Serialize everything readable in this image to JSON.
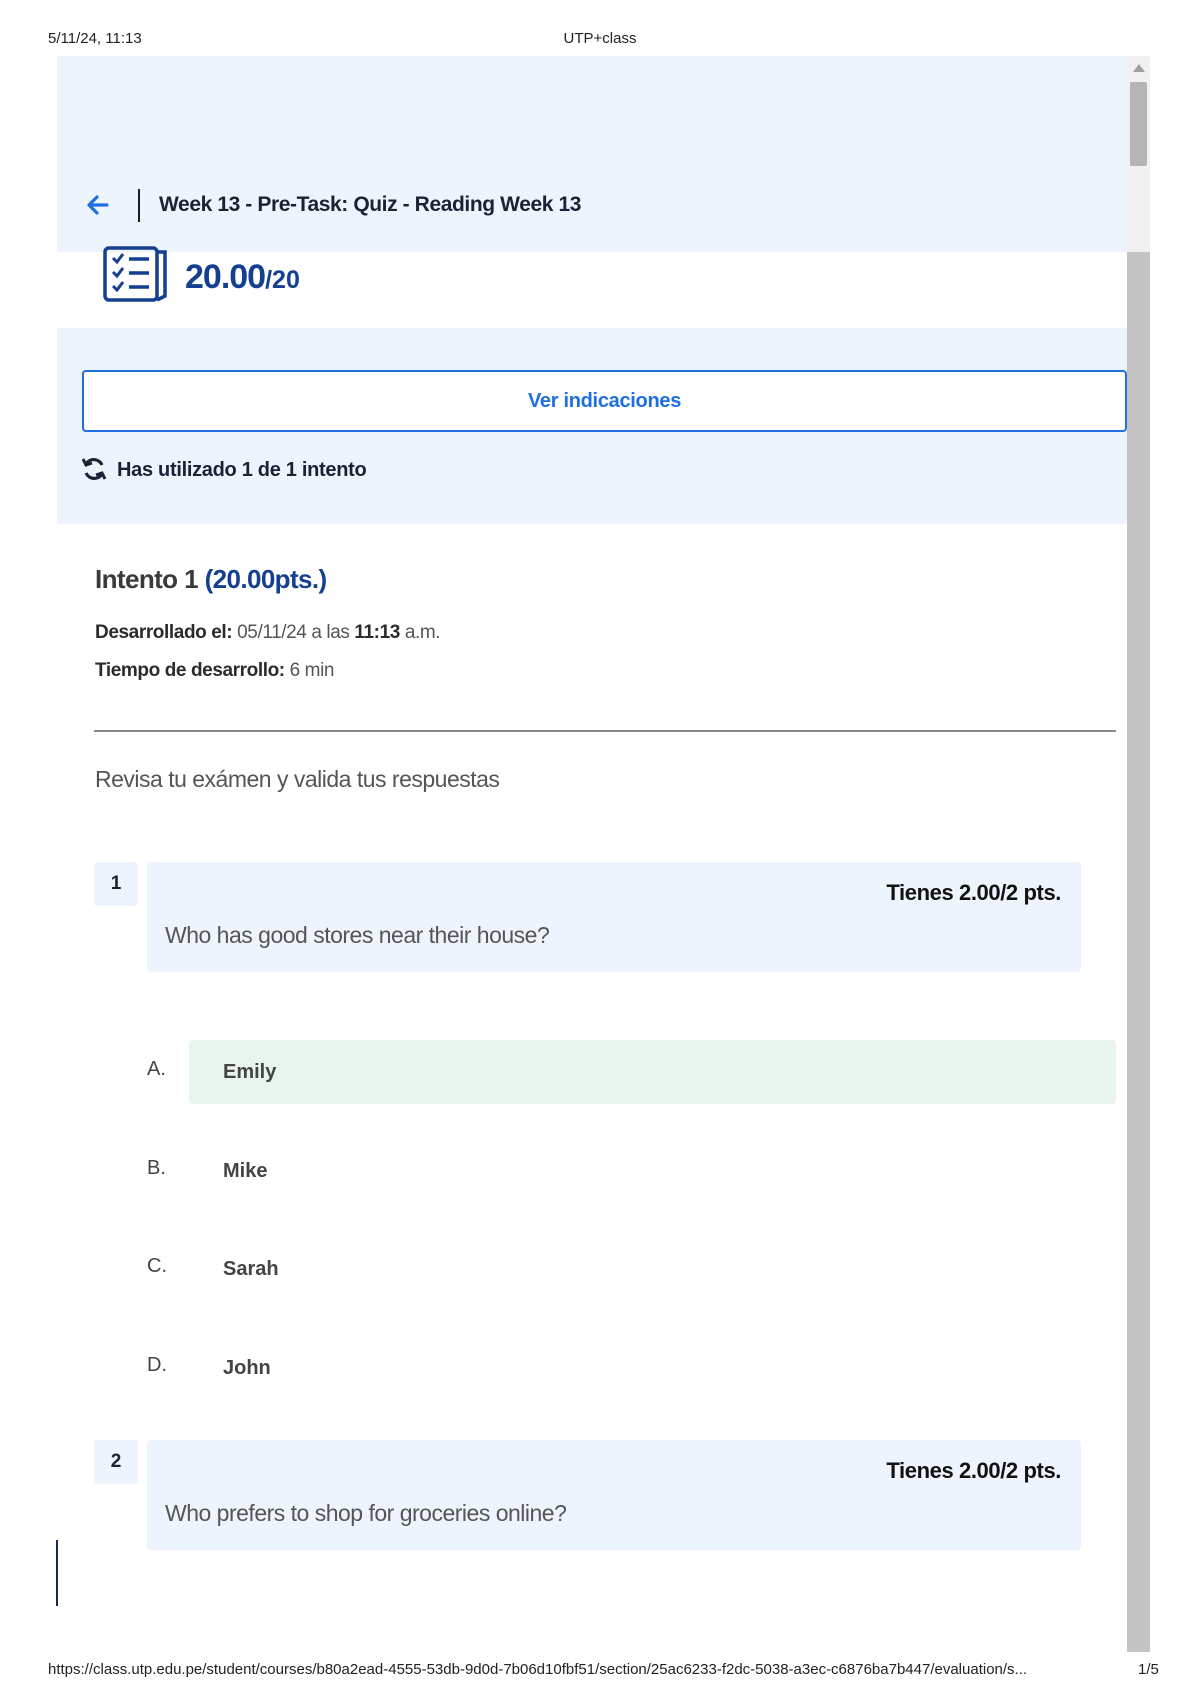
{
  "print": {
    "date": "5/11/24, 11:13",
    "title": "UTP+class",
    "url": "https://class.utp.edu.pe/student/courses/b80a2ead-4555-53db-9d0d-7b06d10fbf51/section/25ac6233-f2dc-5038-a3ec-c6876ba7b447/evaluation/s...",
    "page": "1/5"
  },
  "header": {
    "back_icon": "arrow-left-icon",
    "title": "Week 13 - Pre-Task: Quiz - Reading Week 13"
  },
  "score": {
    "icon": "checklist-icon",
    "value": "20.00",
    "max": "/20"
  },
  "info": {
    "indicaciones_label": "Ver indicaciones",
    "attempts_icon": "refresh-icon",
    "attempts_text": "Has utilizado 1 de 1 intento"
  },
  "attempt": {
    "label": "Intento 1",
    "points": "(20.00pts.)",
    "developed_label": "Desarrollado el:",
    "developed_date": "05/11/24",
    "developed_sep": "a las",
    "developed_time": "11:13",
    "developed_ampm": "a.m.",
    "duration_label": "Tiempo de desarrollo:",
    "duration_value": "6 min"
  },
  "review_text": "Revisa tu exámen y valida tus respuestas",
  "questions": [
    {
      "number": "1",
      "points": "Tienes 2.00/2 pts.",
      "text": "Who has good stores near their house?",
      "options": [
        {
          "letter": "A.",
          "label": "Emily"
        },
        {
          "letter": "B.",
          "label": "Mike"
        },
        {
          "letter": "C.",
          "label": "Sarah"
        },
        {
          "letter": "D.",
          "label": "John"
        }
      ],
      "correct_index": 0
    },
    {
      "number": "2",
      "points": "Tienes 2.00/2 pts.",
      "text": "Who prefers to shop for groceries online?"
    }
  ],
  "colors": {
    "primary": "#1f6fe0",
    "score": "#153f8f",
    "panel_bg": "#eef4fd",
    "correct_bg": "#e8f5ec"
  }
}
